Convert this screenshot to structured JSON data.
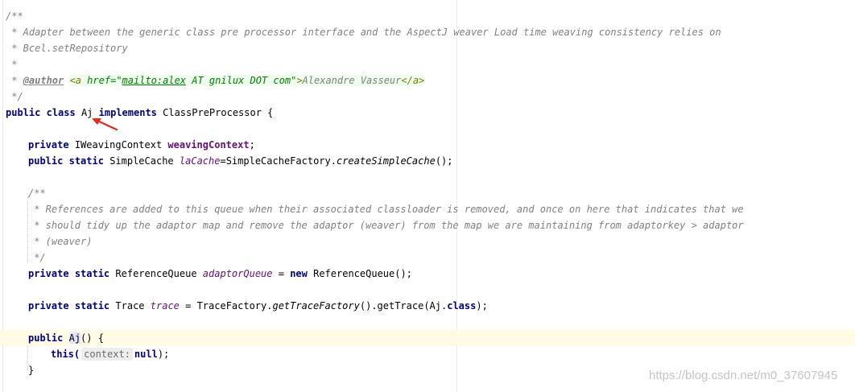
{
  "editor": {
    "lines": {
      "l1": "/**",
      "l2": " * Adapter between the generic class pre processor interface and the AspectJ weaver Load time weaving consistency relies on",
      "l3": " * Bcel.setRepository",
      "l4": " *",
      "l5_prefix": " * ",
      "l5_author": "@author",
      "l5_sp": " ",
      "l5_a_open": "<a",
      "l5_href": " href=",
      "l5_q1": "\"",
      "l5_mailto": "mailto:alex",
      "l5_rest": " AT gnilux DOT com",
      "l5_q2": "\"",
      "l5_gt": ">",
      "l5_name": "Alexandre Vasseur",
      "l5_a_close": "</a>",
      "l6": " */",
      "l7_public": "public",
      "l7_class": "class",
      "l7_name": "Aj",
      "l7_implements": "implements",
      "l7_iface": "ClassPreProcessor {",
      "l9_private": "private",
      "l9_type": "IWeavingContext",
      "l9_field": "weavingContext",
      "l9_end": ";",
      "l10_public": "public",
      "l10_static": "static",
      "l10_type": "SimpleCache",
      "l10_field": "laCache",
      "l10_eq": "=SimpleCacheFactory.",
      "l10_method": "createSimpleCache",
      "l10_end": "();",
      "l12": "/**",
      "l13": " * References are added to this queue when their associated classloader is removed, and once on here that indicates that we",
      "l14": " * should tidy up the adaptor map and remove the adaptor (weaver) from the map we are maintaining from adaptorkey > adaptor",
      "l15": " * (weaver)",
      "l16": " */",
      "l17_private": "private",
      "l17_static": "static",
      "l17_type": "ReferenceQueue",
      "l17_field": "adaptorQueue",
      "l17_eq": " = ",
      "l17_new": "new",
      "l17_end": " ReferenceQueue();",
      "l19_private": "private",
      "l19_static": "static",
      "l19_type": "Trace",
      "l19_field": "trace",
      "l19_eq": " = TraceFactory.",
      "l19_method": "getTraceFactory",
      "l19_mid": "().getTrace(Aj.",
      "l19_class": "class",
      "l19_end": ");",
      "l21_public": "public",
      "l21_name": "Aj",
      "l21_end": "() {",
      "l22_this": "this(",
      "l22_hint": "context:",
      "l22_null": "null",
      "l22_end": ");",
      "l23": "}"
    }
  },
  "watermark": "https://blog.csdn.net/m0_37607945",
  "colors": {
    "keyword": "#000080",
    "doc_comment": "#808080",
    "field": "#660e7a",
    "current_line": "#fffae3",
    "arrow": "#e8281e"
  }
}
